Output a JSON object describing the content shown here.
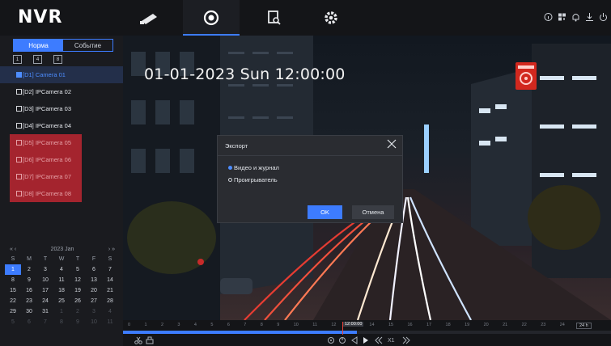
{
  "app": {
    "logo": "NVR"
  },
  "nav": [
    {
      "icon": "camera-icon",
      "active": false
    },
    {
      "icon": "playback-icon",
      "active": true
    },
    {
      "icon": "search-file-icon",
      "active": false
    },
    {
      "icon": "gear-icon",
      "active": false
    }
  ],
  "sidebar": {
    "tabs": [
      {
        "label": "Норма"
      },
      {
        "label": "Событие"
      }
    ],
    "splits": [
      "1",
      "4",
      "8"
    ],
    "cameras": [
      {
        "label": "[D1] Camera 01",
        "state": "selected"
      },
      {
        "label": "[D2] IPCamera 02",
        "state": "normal"
      },
      {
        "label": "[D3] IPCamera 03",
        "state": "normal"
      },
      {
        "label": "[D4] IPCamera 04",
        "state": "normal"
      },
      {
        "label": "[D5] IPCamera 05",
        "state": "offline"
      },
      {
        "label": "[D6] IPCamera 06",
        "state": "offline"
      },
      {
        "label": "[D7] IPCamera 07",
        "state": "offline"
      },
      {
        "label": "[D8] IPCamera 08",
        "state": "offline"
      }
    ]
  },
  "calendar": {
    "prev": "«  ‹",
    "month": "2023 Jan",
    "next": "›  »",
    "weekdays": [
      "S",
      "M",
      "T",
      "W",
      "T",
      "F",
      "S"
    ],
    "days": [
      {
        "d": "1",
        "c": "today"
      },
      {
        "d": "2"
      },
      {
        "d": "3"
      },
      {
        "d": "4"
      },
      {
        "d": "5"
      },
      {
        "d": "6"
      },
      {
        "d": "7"
      },
      {
        "d": "8"
      },
      {
        "d": "9"
      },
      {
        "d": "10"
      },
      {
        "d": "11"
      },
      {
        "d": "12"
      },
      {
        "d": "13"
      },
      {
        "d": "14"
      },
      {
        "d": "15"
      },
      {
        "d": "16"
      },
      {
        "d": "17"
      },
      {
        "d": "18"
      },
      {
        "d": "19"
      },
      {
        "d": "20"
      },
      {
        "d": "21"
      },
      {
        "d": "22"
      },
      {
        "d": "23"
      },
      {
        "d": "24"
      },
      {
        "d": "25"
      },
      {
        "d": "26"
      },
      {
        "d": "27"
      },
      {
        "d": "28"
      },
      {
        "d": "29"
      },
      {
        "d": "30"
      },
      {
        "d": "31"
      },
      {
        "d": "1",
        "c": "dim"
      },
      {
        "d": "2",
        "c": "dim"
      },
      {
        "d": "3",
        "c": "dim"
      },
      {
        "d": "4",
        "c": "dim"
      },
      {
        "d": "5",
        "c": "dim"
      },
      {
        "d": "6",
        "c": "dim"
      },
      {
        "d": "7",
        "c": "dim"
      },
      {
        "d": "8",
        "c": "dim"
      },
      {
        "d": "9",
        "c": "dim"
      },
      {
        "d": "10",
        "c": "dim"
      },
      {
        "d": "11",
        "c": "dim"
      }
    ]
  },
  "video": {
    "osd": "01-01-2023 Sun 12:00:00"
  },
  "dialog": {
    "title": "Экспорт",
    "options": [
      {
        "label": "Видео и журнал",
        "checked": true
      },
      {
        "label": "Проигрыватель",
        "checked": false
      }
    ],
    "ok": "OK",
    "cancel": "Отмена"
  },
  "timeline": {
    "hours": [
      "0",
      "1",
      "2",
      "3",
      "4",
      "5",
      "6",
      "7",
      "8",
      "9",
      "10",
      "11",
      "12",
      "13",
      "14",
      "15",
      "16",
      "17",
      "18",
      "19",
      "20",
      "21",
      "22",
      "23",
      "24"
    ],
    "cursor_label": "12:00:00",
    "zoom": "24 h",
    "recorded_fraction_start": 0.0,
    "recorded_fraction_end": 0.48
  },
  "colors": {
    "accent": "#3d7cff",
    "offline": "#a4242e",
    "record": "#d2281e"
  }
}
